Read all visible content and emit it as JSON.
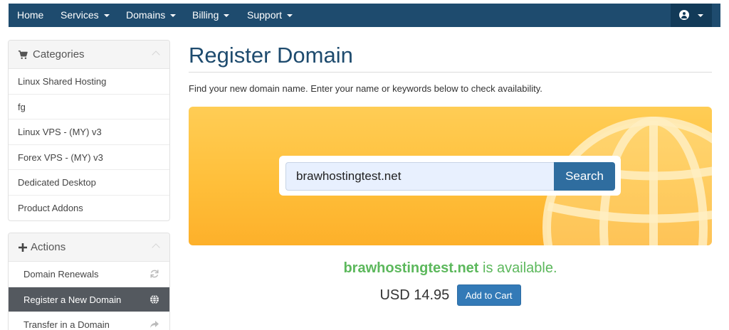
{
  "nav": {
    "items": [
      {
        "label": "Home",
        "dropdown": false
      },
      {
        "label": "Services",
        "dropdown": true
      },
      {
        "label": "Domains",
        "dropdown": true
      },
      {
        "label": "Billing",
        "dropdown": true
      },
      {
        "label": "Support",
        "dropdown": true
      }
    ],
    "account_icon": "user-circle-icon"
  },
  "sidebar": {
    "categories": {
      "title": "Categories",
      "icon": "cart-icon",
      "items": [
        "Linux Shared Hosting",
        "fg",
        "Linux VPS - (MY) v3",
        "Forex VPS - (MY) v3",
        "Dedicated Desktop",
        "Product Addons"
      ]
    },
    "actions": {
      "title": "Actions",
      "icon": "plus-icon",
      "items": [
        {
          "label": "Domain Renewals",
          "icon": "refresh-icon",
          "active": false
        },
        {
          "label": "Register a New Domain",
          "icon": "globe-icon",
          "active": true
        },
        {
          "label": "Transfer in a Domain",
          "icon": "share-icon",
          "active": false
        }
      ]
    }
  },
  "main": {
    "title": "Register Domain",
    "intro": "Find your new domain name. Enter your name or keywords below to check availability.",
    "search": {
      "value": "brawhostingtest.net",
      "button": "Search"
    },
    "result": {
      "domain": "brawhostingtest.net",
      "status_text": "is available."
    },
    "price": "USD 14.95",
    "add_to_cart": "Add to Cart"
  },
  "colors": {
    "navbar": "#1e4b6e",
    "accent": "#2f6d9f",
    "available": "#5cb85c",
    "banner": "#ffc145"
  }
}
